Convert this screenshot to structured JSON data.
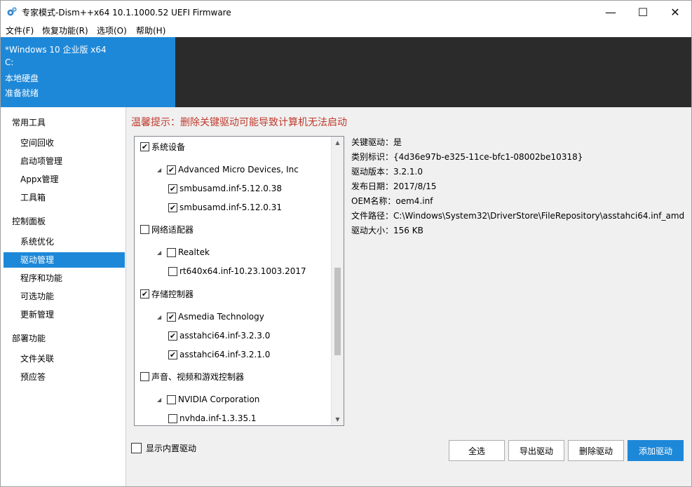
{
  "window": {
    "title": "专家模式-Dism++x64 10.1.1000.52 UEFI Firmware",
    "icon": "gears-icon",
    "controls": {
      "minimize": "—",
      "maximize": "☐",
      "close": "✕"
    }
  },
  "menu": [
    "文件(F)",
    "恢复功能(R)",
    "选项(O)",
    "帮助(H)"
  ],
  "header": {
    "os": "*Windows 10 企业版 x64",
    "drive": "C:",
    "disk": "本地硬盘",
    "status": "准备就绪"
  },
  "sidebar": {
    "groups": [
      {
        "label": "常用工具",
        "items": [
          "空间回收",
          "启动项管理",
          "Appx管理",
          "工具箱"
        ]
      },
      {
        "label": "控制面板",
        "items": [
          "系统优化",
          "驱动管理",
          "程序和功能",
          "可选功能",
          "更新管理"
        ]
      },
      {
        "label": "部署功能",
        "items": [
          "文件关联",
          "预应答"
        ]
      }
    ],
    "active": "驱动管理"
  },
  "warning": "温馨提示：删除关键驱动可能导致计算机无法启动",
  "tree": [
    {
      "level": 0,
      "label": "系统设备",
      "checked": true
    },
    {
      "level": 1,
      "label": "Advanced Micro Devices, Inc",
      "checked": true
    },
    {
      "level": 2,
      "label": "smbusamd.inf-5.12.0.38",
      "checked": true
    },
    {
      "level": 2,
      "label": "smbusamd.inf-5.12.0.31",
      "checked": true
    },
    {
      "level": 0,
      "label": "网络适配器",
      "checked": false
    },
    {
      "level": 1,
      "label": "Realtek",
      "checked": false
    },
    {
      "level": 2,
      "label": "rt640x64.inf-10.23.1003.2017",
      "checked": false
    },
    {
      "level": 0,
      "label": "存储控制器",
      "checked": true
    },
    {
      "level": 1,
      "label": "Asmedia Technology",
      "checked": true
    },
    {
      "level": 2,
      "label": "asstahci64.inf-3.2.3.0",
      "checked": true
    },
    {
      "level": 2,
      "label": "asstahci64.inf-3.2.1.0",
      "checked": true
    },
    {
      "level": 0,
      "label": "声音、视频和游戏控制器",
      "checked": false
    },
    {
      "level": 1,
      "label": "NVIDIA Corporation",
      "checked": false
    },
    {
      "level": 2,
      "label": "nvhda.inf-1.3.35.1",
      "checked": false
    }
  ],
  "properties": [
    {
      "label": "关键驱动：",
      "value": "是"
    },
    {
      "label": "类别标识：",
      "value": "{4d36e97b-e325-11ce-bfc1-08002be10318}"
    },
    {
      "label": "驱动版本：",
      "value": "3.2.1.0"
    },
    {
      "label": "发布日期：",
      "value": "2017/8/15"
    },
    {
      "label": "OEM名称：",
      "value": "oem4.inf"
    },
    {
      "label": "文件路径：",
      "value": "C:\\Windows\\System32\\DriverStore\\FileRepository\\asstahci64.inf_amd"
    },
    {
      "label": "驱动大小：",
      "value": "156 KB"
    }
  ],
  "show_builtin": {
    "label": "显示内置驱动",
    "checked": false
  },
  "buttons": {
    "select_all": "全选",
    "export": "导出驱动",
    "delete": "删除驱动",
    "add": "添加驱动"
  },
  "colors": {
    "accent": "#1e88d8",
    "warning": "#c0392b",
    "header_dark": "#2b2b2b"
  }
}
